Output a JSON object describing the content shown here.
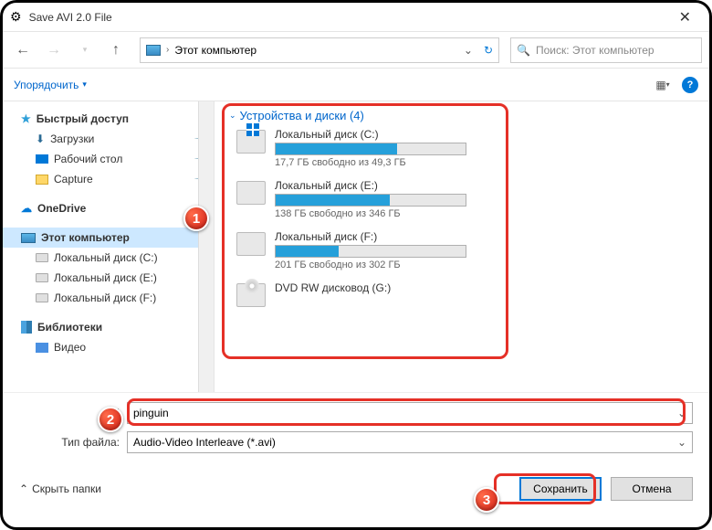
{
  "titlebar": {
    "title": "Save AVI 2.0 File"
  },
  "navbar": {
    "breadcrumb": "Этот компьютер",
    "search_placeholder": "Поиск: Этот компьютер"
  },
  "toolbar": {
    "organize": "Упорядочить"
  },
  "sidebar": {
    "quick_access": "Быстрый доступ",
    "downloads": "Загрузки",
    "desktop": "Рабочий стол",
    "capture": "Capture",
    "onedrive": "OneDrive",
    "this_pc": "Этот компьютер",
    "disk_c": "Локальный диск (C:)",
    "disk_e": "Локальный диск (E:)",
    "disk_f": "Локальный диск (F:)",
    "libraries": "Библиотеки",
    "video": "Видео"
  },
  "content": {
    "section": "Устройства и диски (4)",
    "drives": [
      {
        "name": "Локальный диск (C:)",
        "free": "17,7 ГБ свободно из 49,3 ГБ",
        "fill": 64
      },
      {
        "name": "Локальный диск (E:)",
        "free": "138 ГБ свободно из 346 ГБ",
        "fill": 60
      },
      {
        "name": "Локальный диск (F:)",
        "free": "201 ГБ свободно из 302 ГБ",
        "fill": 33
      }
    ],
    "dvd": "DVD RW дисковод (G:)"
  },
  "bottom": {
    "filename_value": "pinguin",
    "filetype_label": "Тип файла:",
    "filetype_value": "Audio-Video Interleave (*.avi)"
  },
  "footer": {
    "hide_folders": "Скрыть папки",
    "save": "Сохранить",
    "cancel": "Отмена"
  },
  "markers": {
    "m1": "1",
    "m2": "2",
    "m3": "3"
  }
}
